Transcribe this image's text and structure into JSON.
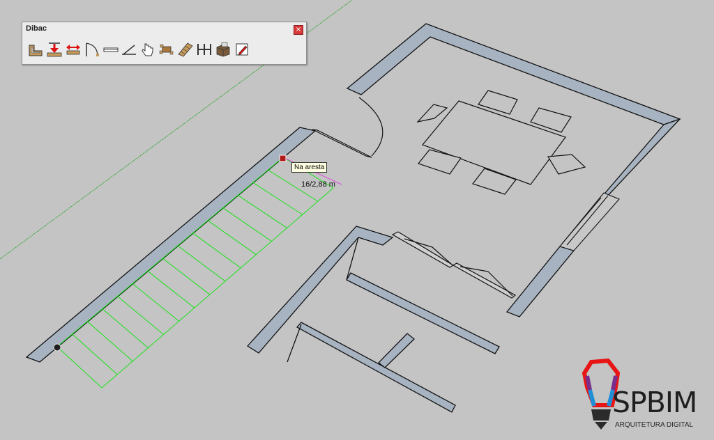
{
  "toolbar": {
    "title": "Dibac",
    "close_glyph": "×",
    "buttons": [
      {
        "name": "wall-tool",
        "icon": "wall-icon"
      },
      {
        "name": "wall-from-line",
        "icon": "wall-down-arrow-icon"
      },
      {
        "name": "wall-extend",
        "icon": "wall-extend-arrows-icon"
      },
      {
        "name": "door-tool",
        "icon": "door-swing-icon"
      },
      {
        "name": "window-tool",
        "icon": "window-icon"
      },
      {
        "name": "sliding-door-tool",
        "icon": "sliding-door-icon"
      },
      {
        "name": "hand-select-tool",
        "icon": "hand-icon"
      },
      {
        "name": "furniture-tool",
        "icon": "table-chairs-icon"
      },
      {
        "name": "stair-tool",
        "icon": "stairs-icon"
      },
      {
        "name": "rail-tool",
        "icon": "rail-icon"
      },
      {
        "name": "3d-convert-tool",
        "icon": "3d-box-icon"
      },
      {
        "name": "properties-tool",
        "icon": "pencil-edit-icon"
      }
    ]
  },
  "viewport": {
    "tooltip": "Na aresta",
    "dimension_readout": "16/2,88 m"
  },
  "logo": {
    "brand": "SPBIM",
    "tagline": "ARQUITETURA DIGITAL"
  }
}
